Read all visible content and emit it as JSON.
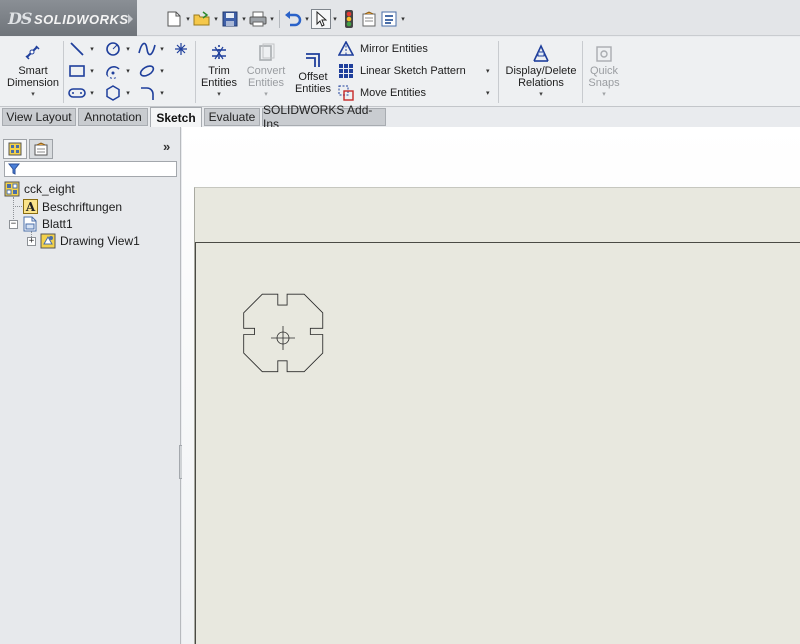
{
  "app": {
    "brand_prefix": "DS",
    "brand_name": "SOLIDWORKS"
  },
  "quick_access": {
    "icons": [
      "new-document-icon",
      "open-folder-icon",
      "save-icon",
      "print-icon",
      "undo-icon",
      "select-arrow-icon",
      "rebuild-traffic-light-icon",
      "file-properties-icon",
      "options-icon"
    ]
  },
  "ribbon": {
    "smart_dimension": {
      "line1": "Smart",
      "line2": "Dimension"
    },
    "trim_entities": {
      "line1": "Trim",
      "line2": "Entities"
    },
    "convert_entities": {
      "line1": "Convert",
      "line2": "Entities"
    },
    "offset_entities": {
      "line1": "Offset",
      "line2": "Entities"
    },
    "mirror_entities": "Mirror Entities",
    "linear_sketch_pattern": "Linear Sketch Pattern",
    "move_entities": "Move Entities",
    "display_delete_relations": {
      "line1": "Display/Delete",
      "line2": "Relations"
    },
    "quick_snaps": {
      "line1": "Quick",
      "line2": "Snaps"
    }
  },
  "tabs": [
    {
      "label": "View Layout",
      "active": false
    },
    {
      "label": "Annotation",
      "active": false
    },
    {
      "label": "Sketch",
      "active": true
    },
    {
      "label": "Evaluate",
      "active": false
    },
    {
      "label": "SOLIDWORKS Add-Ins",
      "active": false
    }
  ],
  "feature_tree": {
    "expand_symbol": "»",
    "root": "cck_eight",
    "annotations": "Beschriftungen",
    "sheet": "Blatt1",
    "drawing_view": "Drawing View1",
    "toggle_sheet": "−",
    "toggle_view": "+"
  },
  "colors": {
    "sheet_background": "#e8e8df",
    "ribbon_icon_blue": "#1f3f9c",
    "tree_icon_yellow": "#f3d14a"
  }
}
